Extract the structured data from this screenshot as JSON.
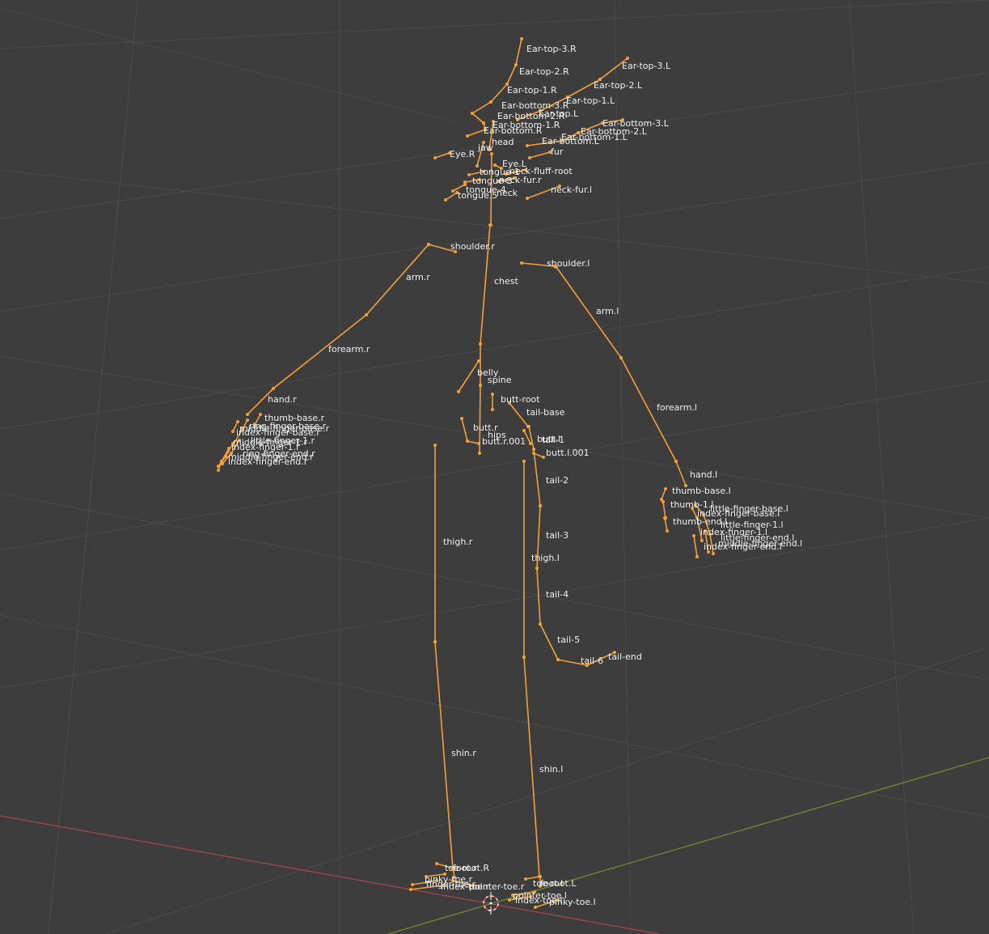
{
  "viewport": {
    "background": "#3d3d3d",
    "grid_color": "#4a4a4a",
    "x_axis_color": "#a0464c",
    "y_axis_color": "#6b8e2e",
    "bone_color": "#f4a038",
    "label_color": "#f0f0f0",
    "cursor": "3d-cursor-icon"
  },
  "bones": [
    {
      "name": "Ear-top-3.R"
    },
    {
      "name": "Ear-top-2.R"
    },
    {
      "name": "Ear-top-1.R"
    },
    {
      "name": "Ear-top-3.L"
    },
    {
      "name": "Ear-top-2.L"
    },
    {
      "name": "Ear-top-1.L"
    },
    {
      "name": "Ear-bottom-3.R"
    },
    {
      "name": "Ear-bottom-2.R"
    },
    {
      "name": "Ear-bottom-1.R"
    },
    {
      "name": "Ear-bottom.R"
    },
    {
      "name": "Ear-top.L"
    },
    {
      "name": "Ear-bottom-3.L"
    },
    {
      "name": "Ear-bottom-2.L"
    },
    {
      "name": "Ear-bottom-1.L"
    },
    {
      "name": "Ear-bottom.L"
    },
    {
      "name": "head"
    },
    {
      "name": "jaw"
    },
    {
      "name": "Eye.R"
    },
    {
      "name": "Eye.L"
    },
    {
      "name": "fur"
    },
    {
      "name": "neck-fluff-root"
    },
    {
      "name": "neck-fur.r"
    },
    {
      "name": "neck-fur.l"
    },
    {
      "name": "tongue-1"
    },
    {
      "name": "tongue-3"
    },
    {
      "name": "tongue-4"
    },
    {
      "name": "tongue.5"
    },
    {
      "name": "neck"
    },
    {
      "name": "shoulder.r"
    },
    {
      "name": "shoulder.l"
    },
    {
      "name": "arm.r"
    },
    {
      "name": "arm.l"
    },
    {
      "name": "chest"
    },
    {
      "name": "forearm.r"
    },
    {
      "name": "forearm.l"
    },
    {
      "name": "hand.r"
    },
    {
      "name": "hand.l"
    },
    {
      "name": "belly"
    },
    {
      "name": "spine"
    },
    {
      "name": "butt-root"
    },
    {
      "name": "tail-base"
    },
    {
      "name": "butt.r"
    },
    {
      "name": "hips"
    },
    {
      "name": "butt.r.001"
    },
    {
      "name": "butt.l"
    },
    {
      "name": "tail-1"
    },
    {
      "name": "butt.l.001"
    },
    {
      "name": "tail-2"
    },
    {
      "name": "tail-3"
    },
    {
      "name": "tail-4"
    },
    {
      "name": "tail-5"
    },
    {
      "name": "tail-6"
    },
    {
      "name": "tail-end"
    },
    {
      "name": "thigh.r"
    },
    {
      "name": "thigh.l"
    },
    {
      "name": "shin.r"
    },
    {
      "name": "shin.l"
    },
    {
      "name": "thumb-base.r"
    },
    {
      "name": "ring-finger-base.r"
    },
    {
      "name": "middle-finger-base.r"
    },
    {
      "name": "index-finger-base.r"
    },
    {
      "name": "little-finger-1.r"
    },
    {
      "name": "middle-finger-1.r"
    },
    {
      "name": "index-finger-1.r"
    },
    {
      "name": "ring-finger-end.r"
    },
    {
      "name": "middle-finger-end.r"
    },
    {
      "name": "index-finger-end.r"
    },
    {
      "name": "thumb-base.l"
    },
    {
      "name": "thumb-1.l"
    },
    {
      "name": "little-finger-base.l"
    },
    {
      "name": "index-finger-base.l"
    },
    {
      "name": "thumb-end.l"
    },
    {
      "name": "little-finger-1.l"
    },
    {
      "name": "index-finger-1.l"
    },
    {
      "name": "little-finger-end.l"
    },
    {
      "name": "middle-finger-end.l"
    },
    {
      "name": "index-finger-end.l"
    },
    {
      "name": "toe-root.R"
    },
    {
      "name": "foot.r"
    },
    {
      "name": "pinky-toe.r"
    },
    {
      "name": "pointer-toe.r"
    },
    {
      "name": "finger-toe.r"
    },
    {
      "name": "index-toe.r"
    },
    {
      "name": "toe-root.L"
    },
    {
      "name": "foot.l"
    },
    {
      "name": "pointer-toe.l"
    },
    {
      "name": "index-toe.l"
    },
    {
      "name": "pinky-toe.l"
    }
  ]
}
